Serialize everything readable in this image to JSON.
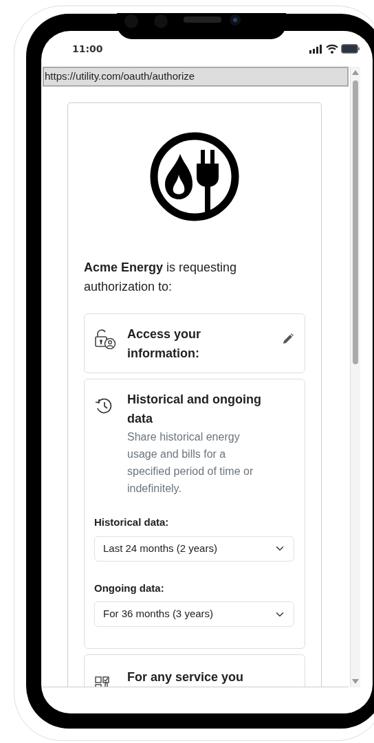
{
  "status_bar": {
    "time": "11:00"
  },
  "browser": {
    "url": "https://utility.com/oauth/authorize"
  },
  "intro": "**Acme Energy** is requesting authorization to:",
  "sections": [
    {
      "kind": "scope",
      "title": "Access your information:",
      "editable": true
    },
    {
      "kind": "data",
      "title": "Historical and ongoing data",
      "description": "Share historical energy usage and bills for a specified period of time or indefinitely.",
      "fields": [
        {
          "label": "Historical data:",
          "value": "Last 24 months (2 years)"
        },
        {
          "label": "Ongoing data:",
          "value": "For 36 months (3 years)"
        }
      ]
    },
    {
      "kind": "service",
      "title": "For any service you"
    }
  ]
}
